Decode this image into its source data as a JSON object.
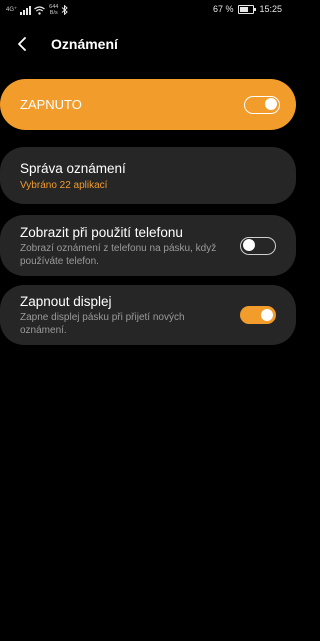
{
  "status_bar": {
    "network_label": "4G⁺",
    "speed_value": "644",
    "speed_unit": "B/s",
    "battery_percent_text": "67 %",
    "battery_level": 0.67,
    "time": "15:25"
  },
  "header": {
    "title": "Oznámení"
  },
  "master": {
    "label": "ZAPNUTO",
    "enabled": true
  },
  "items": [
    {
      "title": "Správa oznámení",
      "subtitle": "Vybráno 22 aplikací"
    },
    {
      "title": "Zobrazit při použití telefonu",
      "subtitle": "Zobrazí oznámení z telefonu na pásku, když používáte telefon.",
      "enabled": false
    },
    {
      "title": "Zapnout displej",
      "subtitle": "Zapne displej pásku při přijetí nových oznámení.",
      "enabled": true
    }
  ],
  "colors": {
    "accent": "#f29c2b",
    "card": "#262626",
    "background": "#000000"
  }
}
